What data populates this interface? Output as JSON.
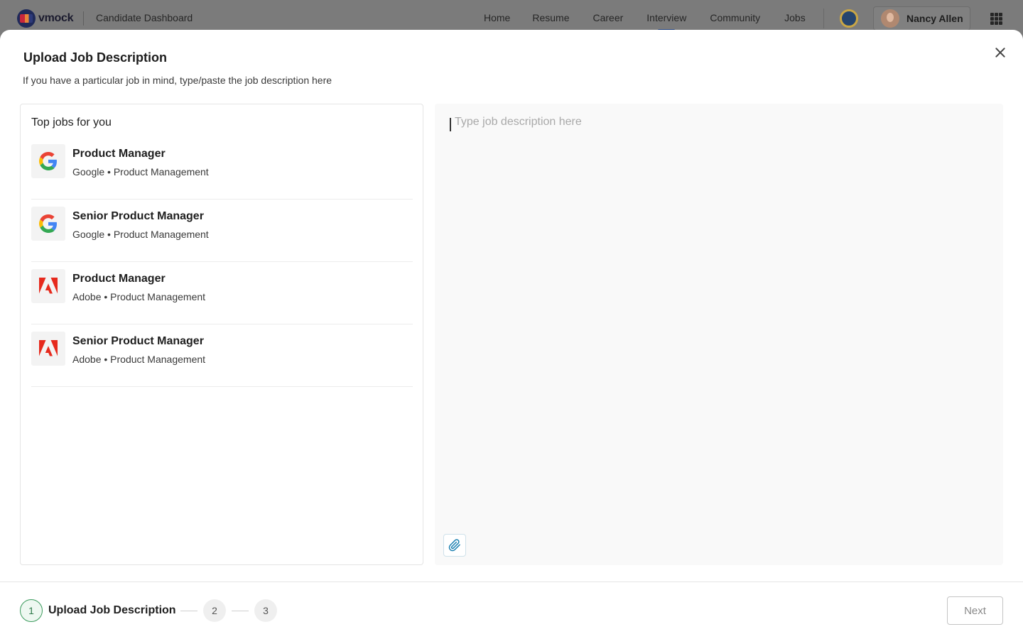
{
  "topnav": {
    "logo_text": "vmock",
    "title": "Candidate Dashboard",
    "links": [
      "Home",
      "Resume",
      "Career",
      "Interview",
      "Community",
      "Jobs"
    ],
    "active_link": "Interview",
    "user_name": "Nancy Allen"
  },
  "modal": {
    "title": "Upload Job Description",
    "subtitle": "If you have a particular job in mind, type/paste the job description here",
    "jobs_heading": "Top jobs for you",
    "jobs": [
      {
        "title": "Product Manager",
        "company": "Google",
        "category": "Product Management",
        "logo": "google-logo-icon"
      },
      {
        "title": "Senior Product Manager",
        "company": "Google",
        "category": "Product Management",
        "logo": "google-logo-icon"
      },
      {
        "title": "Product Manager",
        "company": "Adobe",
        "category": "Product Management",
        "logo": "adobe-logo-icon"
      },
      {
        "title": "Senior Product Manager",
        "company": "Adobe",
        "category": "Product Management",
        "logo": "adobe-logo-icon"
      }
    ],
    "editor_placeholder": "Type job description here",
    "editor_value": ""
  },
  "footer": {
    "current_step": "1",
    "current_step_label": "Upload Job Description",
    "step_2": "2",
    "step_3": "3",
    "next_label": "Next"
  },
  "colors": {
    "accent_green": "#3a9a5c",
    "google_blue": "#4285F4",
    "adobe_red": "#E62A1D"
  }
}
